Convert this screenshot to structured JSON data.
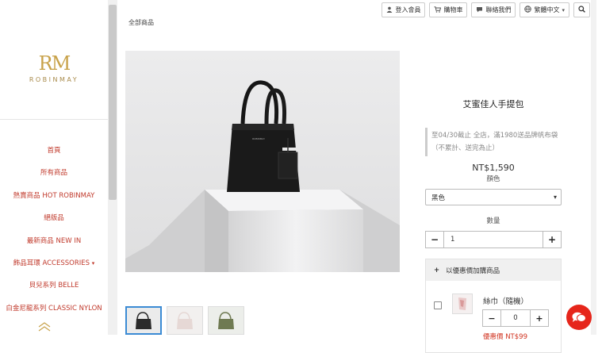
{
  "logo": {
    "monogram": "RM",
    "wordmark": "ROBINMAY"
  },
  "nav": {
    "items": [
      {
        "label": "首頁"
      },
      {
        "label": "所有商品"
      },
      {
        "label": "熱賣商品 HOT ROBINMAY"
      },
      {
        "label": "絕版品"
      },
      {
        "label": "最新商品 NEW IN"
      },
      {
        "label": "飾品耳環 ACCESSORIES ",
        "caret": "▾"
      },
      {
        "label": "貝兒系列 BELLE"
      },
      {
        "label": "白金尼龍系列 CLASSIC NYLON"
      }
    ]
  },
  "topbar": {
    "login": "登入會員",
    "cart": "購物車",
    "contact": "聯絡我們",
    "language": "繁體中文"
  },
  "breadcrumb": "全部商品",
  "product": {
    "bag_brand_text": "ROBINMAY",
    "title": "艾蜜佳人手提包",
    "promo": "至04/30截止 全店，滿1980送品牌帆布袋（不累計、送完為止）",
    "price": "NT$1,590",
    "color_label": "顏色",
    "color_value": "黑色",
    "qty_label": "數量",
    "qty_value": "1",
    "thumb_colors": [
      "#2a2a2a",
      "#e6d8d5",
      "#6f7a52"
    ]
  },
  "addon": {
    "header": "以優惠價加購商品",
    "item_name": "絲巾（隨機）",
    "qty": "0",
    "price": "優惠價 NT$99"
  },
  "colors": {
    "accent": "#c0392b",
    "gold": "#c8a24a",
    "promo_price": "#d0321f",
    "chat": "#e6261b",
    "thumb_active": "#3b8bd4"
  }
}
